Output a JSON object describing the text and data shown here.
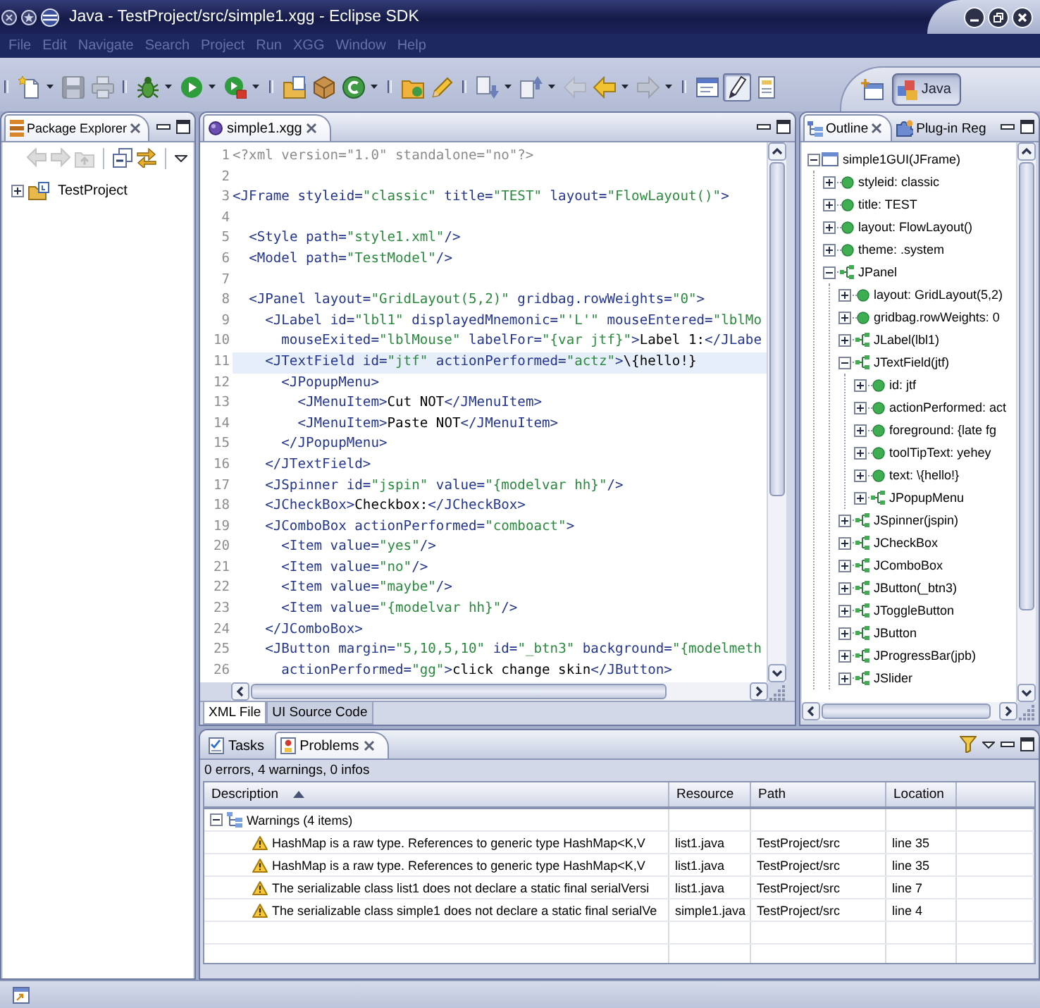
{
  "window": {
    "title": "Java - TestProject/src/simple1.xgg - Eclipse SDK"
  },
  "menu_bar": [
    "File",
    "Edit",
    "Navigate",
    "Search",
    "Project",
    "Run",
    "XGG",
    "Window",
    "Help"
  ],
  "toolbar": [
    [
      {
        "kind": "new",
        "disabled": false,
        "dropdown": true,
        "pressed": false
      },
      {
        "kind": "save",
        "disabled": true,
        "dropdown": false,
        "pressed": false
      },
      {
        "kind": "print",
        "disabled": true,
        "dropdown": false,
        "pressed": false
      }
    ],
    [
      {
        "kind": "debug",
        "disabled": false,
        "dropdown": true,
        "pressed": false
      },
      {
        "kind": "run",
        "disabled": false,
        "dropdown": true,
        "pressed": false
      },
      {
        "kind": "tools",
        "disabled": false,
        "dropdown": true,
        "pressed": false
      }
    ],
    [
      {
        "kind": "project",
        "disabled": false,
        "dropdown": false,
        "pressed": false
      },
      {
        "kind": "package",
        "disabled": false,
        "dropdown": false,
        "pressed": false
      },
      {
        "kind": "class",
        "disabled": false,
        "dropdown": true,
        "pressed": false
      }
    ],
    [
      {
        "kind": "opentype",
        "disabled": false,
        "dropdown": false,
        "pressed": false
      },
      {
        "kind": "pencil",
        "disabled": false,
        "dropdown": false,
        "pressed": false
      }
    ],
    [
      {
        "kind": "nextannotation",
        "disabled": false,
        "dropdown": true,
        "pressed": false
      },
      {
        "kind": "prevannotation",
        "disabled": false,
        "dropdown": true,
        "pressed": false
      },
      {
        "kind": "lastedit",
        "disabled": true,
        "dropdown": false,
        "pressed": false
      },
      {
        "kind": "back",
        "disabled": false,
        "dropdown": true,
        "pressed": false
      },
      {
        "kind": "forward",
        "disabled": true,
        "dropdown": true,
        "pressed": false
      }
    ],
    [
      {
        "kind": "breadcrumb",
        "disabled": false,
        "dropdown": false,
        "pressed": false
      },
      {
        "kind": "occurrences",
        "disabled": false,
        "dropdown": false,
        "pressed": true
      },
      {
        "kind": "sourceonly",
        "disabled": false,
        "dropdown": false,
        "pressed": false
      }
    ]
  ],
  "perspective_bar": [
    {
      "label": "Java",
      "selected": true
    }
  ],
  "package_explorer": {
    "tab": {
      "label": "Package Explorer",
      "selected": true
    },
    "toolbar": [
      [
        {
          "kind": "back",
          "disabled": true
        },
        {
          "kind": "forward",
          "disabled": true
        },
        {
          "kind": "up",
          "disabled": true
        }
      ],
      [
        {
          "kind": "collapse",
          "disabled": false
        },
        {
          "kind": "link",
          "disabled": false
        }
      ]
    ],
    "tree": [
      {
        "label": "TestProject",
        "kind": "project",
        "expanded": false,
        "selected": false
      }
    ]
  },
  "editor": {
    "tab": {
      "label": "simple1.xgg",
      "selected": true
    },
    "lines": [
      {
        "number": "1",
        "text": "<?xml version=\"1.0\" standalone=\"no\"?>",
        "current": false
      },
      {
        "number": "2",
        "current": false
      },
      {
        "number": "3",
        "text": "<JFrame styleid=\"classic\" title=\"TEST\" layout=\"FlowLayout()\">",
        "current": false
      },
      {
        "number": "4",
        "current": false
      },
      {
        "number": "5",
        "text": "  <Style path=\"style1.xml\"/>",
        "current": false
      },
      {
        "number": "6",
        "text": "  <Model path=\"TestModel\"/>",
        "current": false
      },
      {
        "number": "7",
        "current": false
      },
      {
        "number": "8",
        "text": "  <JPanel layout=\"GridLayout(5,2)\" gridbag.rowWeights=\"0\">",
        "current": false
      },
      {
        "number": "9",
        "text": "    <JLabel id=\"lbl1\" displayedMnemonic=\"'L'\" mouseEntered=\"lblMo",
        "current": false
      },
      {
        "number": "10",
        "text": "      mouseExited=\"lblMouse\" labelFor=\"{var jtf}\">Label 1:</JLabe",
        "current": false
      },
      {
        "number": "11",
        "text": "    <JTextField id=\"jtf\" actionPerformed=\"actz\">\\{hello!}",
        "current": true
      },
      {
        "number": "12",
        "text": "      <JPopupMenu>",
        "current": false
      },
      {
        "number": "13",
        "text": "        <JMenuItem>Cut NOT</JMenuItem>",
        "current": false
      },
      {
        "number": "14",
        "text": "        <JMenuItem>Paste NOT</JMenuItem>",
        "current": false
      },
      {
        "number": "15",
        "text": "      </JPopupMenu>",
        "current": false
      },
      {
        "number": "16",
        "text": "    </JTextField>",
        "current": false
      },
      {
        "number": "17",
        "text": "    <JSpinner id=\"jspin\" value=\"{modelvar hh}\"/>",
        "current": false
      },
      {
        "number": "18",
        "text": "    <JCheckBox>Checkbox:</JCheckBox>",
        "current": false
      },
      {
        "number": "19",
        "text": "    <JComboBox actionPerformed=\"comboact\">",
        "current": false
      },
      {
        "number": "20",
        "text": "      <Item value=\"yes\"/>",
        "current": false
      },
      {
        "number": "21",
        "text": "      <Item value=\"no\"/>",
        "current": false
      },
      {
        "number": "22",
        "text": "      <Item value=\"maybe\"/>",
        "current": false
      },
      {
        "number": "23",
        "text": "      <Item value=\"{modelvar hh}\"/>",
        "current": false
      },
      {
        "number": "24",
        "text": "    </JComboBox>",
        "current": false
      },
      {
        "number": "25",
        "text": "    <JButton margin=\"5,10,5,10\" id=\"_btn3\" background=\"{modelmeth",
        "current": false
      },
      {
        "number": "26",
        "text": "      actionPerformed=\"gg\">click change skin</JButton>",
        "current": false
      }
    ],
    "bottom_tabs": [
      {
        "label": "XML File",
        "selected": true
      },
      {
        "label": "UI Source Code",
        "selected": false
      }
    ]
  },
  "outline": {
    "tabs": [
      {
        "label": "Outline",
        "selected": true
      },
      {
        "label": "Plug-in Reg",
        "selected": false
      }
    ],
    "tree": [
      {
        "label": "simple1GUI(JFrame)",
        "kind": "frame",
        "expanded": true,
        "selected": false,
        "children": [
          {
            "label": "styleid: classic",
            "kind": "property",
            "expanded": false,
            "selected": false
          },
          {
            "label": "title: TEST",
            "kind": "property",
            "expanded": false,
            "selected": false
          },
          {
            "label": "layout: FlowLayout()",
            "kind": "property",
            "expanded": false,
            "selected": false
          },
          {
            "label": "theme: .system",
            "kind": "property",
            "expanded": false,
            "selected": false
          },
          {
            "label": "JPanel",
            "kind": "component",
            "expanded": true,
            "selected": false,
            "children": [
              {
                "label": "layout: GridLayout(5,2)",
                "kind": "property",
                "expanded": false,
                "selected": false
              },
              {
                "label": "gridbag.rowWeights: 0",
                "kind": "property",
                "expanded": false,
                "selected": false
              },
              {
                "label": "JLabel(lbl1)",
                "kind": "component",
                "expanded": false,
                "selected": false
              },
              {
                "label": "JTextField(jtf)",
                "kind": "component",
                "expanded": true,
                "selected": false,
                "children": [
                  {
                    "label": "id: jtf",
                    "kind": "property",
                    "expanded": false,
                    "selected": false
                  },
                  {
                    "label": "actionPerformed: act",
                    "kind": "property",
                    "expanded": false,
                    "selected": false
                  },
                  {
                    "label": "foreground: {late fg",
                    "kind": "property",
                    "expanded": false,
                    "selected": false
                  },
                  {
                    "label": "toolTipText: yehey",
                    "kind": "property",
                    "expanded": false,
                    "selected": false
                  },
                  {
                    "label": "text: \\{hello!}",
                    "kind": "property",
                    "expanded": false,
                    "selected": false
                  },
                  {
                    "label": "JPopupMenu",
                    "kind": "component",
                    "expanded": false,
                    "selected": false
                  }
                ]
              },
              {
                "label": "JSpinner(jspin)",
                "kind": "component",
                "expanded": false,
                "selected": false
              },
              {
                "label": "JCheckBox",
                "kind": "component",
                "expanded": false,
                "selected": false
              },
              {
                "label": "JComboBox",
                "kind": "component",
                "expanded": false,
                "selected": false
              },
              {
                "label": "JButton(_btn3)",
                "kind": "component",
                "expanded": false,
                "selected": false
              },
              {
                "label": "JToggleButton",
                "kind": "component",
                "expanded": false,
                "selected": false
              },
              {
                "label": "JButton",
                "kind": "component",
                "expanded": false,
                "selected": false
              },
              {
                "label": "JProgressBar(jpb)",
                "kind": "component",
                "expanded": false,
                "selected": false
              },
              {
                "label": "JSlider",
                "kind": "component",
                "expanded": false,
                "selected": false
              }
            ]
          }
        ]
      }
    ]
  },
  "problems": {
    "tabs": [
      {
        "label": "Tasks",
        "selected": false
      },
      {
        "label": "Problems",
        "selected": true
      }
    ],
    "summary": "0 errors, 4 warnings, 0 infos",
    "columns": [
      {
        "label": "Description",
        "sorted": true
      },
      {
        "label": "Resource",
        "sorted": false
      },
      {
        "label": "Path",
        "sorted": false
      },
      {
        "label": "Location",
        "sorted": false
      }
    ],
    "groups": [
      {
        "label": "Warnings (4 items)",
        "expanded": true,
        "selected": false,
        "rows": [
          {
            "description": "HashMap is a raw type. References to generic type HashMap<K,V",
            "resource": "list1.java",
            "path": "TestProject/src",
            "location": "line 35",
            "selected": false
          },
          {
            "description": "HashMap is a raw type. References to generic type HashMap<K,V",
            "resource": "list1.java",
            "path": "TestProject/src",
            "location": "line 35",
            "selected": false
          },
          {
            "description": "The serializable class list1 does not declare a static final serialVersi",
            "resource": "list1.java",
            "path": "TestProject/src",
            "location": "line 7",
            "selected": false
          },
          {
            "description": "The serializable class simple1 does not declare a static final serialVe",
            "resource": "simple1.java",
            "path": "TestProject/src",
            "location": "line 4",
            "selected": false
          }
        ]
      }
    ]
  }
}
